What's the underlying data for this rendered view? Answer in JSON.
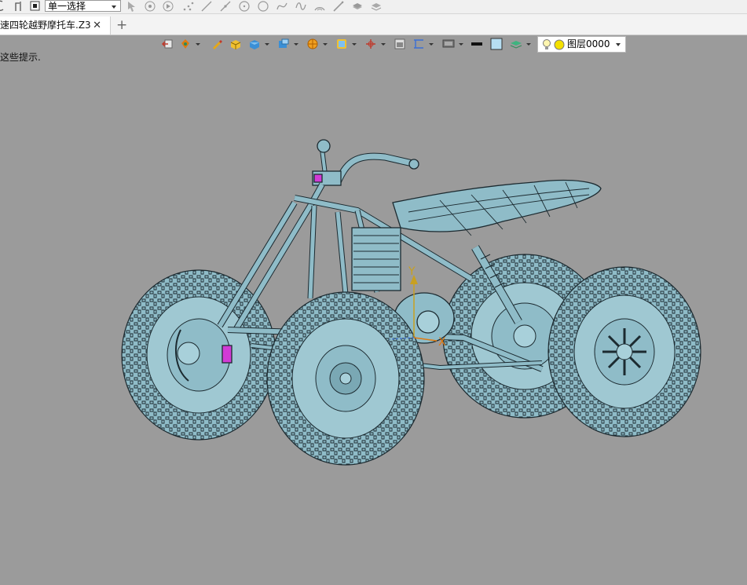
{
  "toolbar_top": {
    "select_mode": "单一选择"
  },
  "tabs": [
    {
      "label": "速四轮越野摩托车.Z3",
      "close": "✕"
    }
  ],
  "new_tab": "+",
  "hint_text": "这些提示.",
  "view_toolbar": {
    "layer_label": "图层0000"
  },
  "axes": {
    "y_label": "Y",
    "x_label": "X"
  },
  "colors": {
    "viewport_bg": "#9b9b9b",
    "model_fill": "#8fbcc8",
    "model_line": "#1c2a30",
    "accent_magenta": "#d23bd6",
    "axis_y": "#c8a020",
    "axis_x": "#e07a10"
  }
}
